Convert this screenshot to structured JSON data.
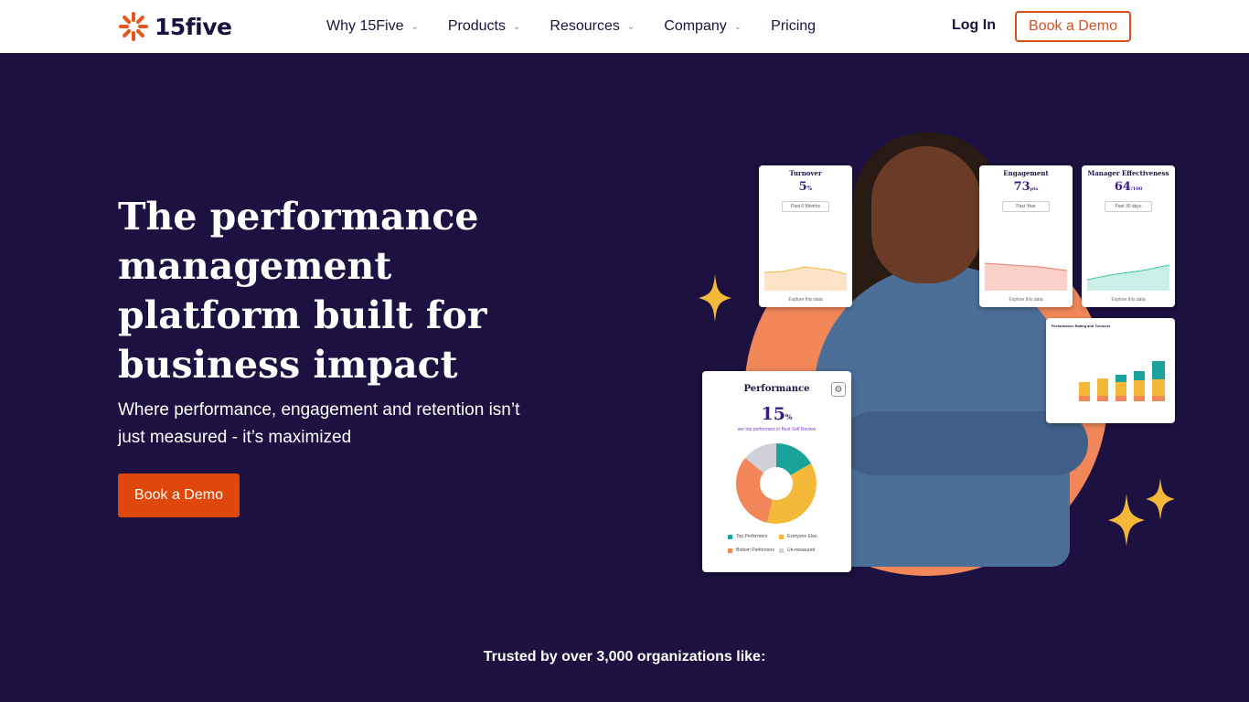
{
  "nav": {
    "logo_text": "15five",
    "menu": [
      {
        "label": "Why 15Five",
        "has_dropdown": true
      },
      {
        "label": "Products",
        "has_dropdown": true
      },
      {
        "label": "Resources",
        "has_dropdown": true
      },
      {
        "label": "Company",
        "has_dropdown": true
      },
      {
        "label": "Pricing",
        "has_dropdown": false
      }
    ],
    "login_label": "Log In",
    "demo_label": "Book a Demo"
  },
  "hero": {
    "title": "The performance management platform built for business impact",
    "subtitle": "Where performance, engagement and retention isn’t just measured - it’s maximized",
    "cta_label": "Book a Demo"
  },
  "cards": {
    "turnover": {
      "title": "Turnover",
      "value": "5",
      "unit": "%",
      "button": "Past 6 Months"
    },
    "engagement": {
      "title": "Engagement",
      "value": "73",
      "unit": "pts",
      "button": "Past Year"
    },
    "manager": {
      "title": "Manager Effectiveness",
      "value": "64",
      "unit": "/100",
      "button": "Past 30 days"
    },
    "explore_label": "Explore this data",
    "performance": {
      "title": "Performance",
      "value": "15",
      "unit": "%",
      "subtitle": "are top performers in Best Self Review",
      "legend": [
        {
          "label": "Top Performers",
          "color": "#1aa39a"
        },
        {
          "label": "Everyone Else",
          "color": "#f5b93a"
        },
        {
          "label": "Bottom Performers",
          "color": "#f2885a"
        },
        {
          "label": "Un-measured",
          "color": "#d0d0d8"
        }
      ]
    },
    "rating": {
      "title": "Performance Rating and Turnover"
    }
  },
  "trusted_text": "Trusted by over 3,000 organizations like:",
  "colors": {
    "background": "#1c1140",
    "accent": "#e0470c",
    "nav_bg": "#ffffff"
  }
}
